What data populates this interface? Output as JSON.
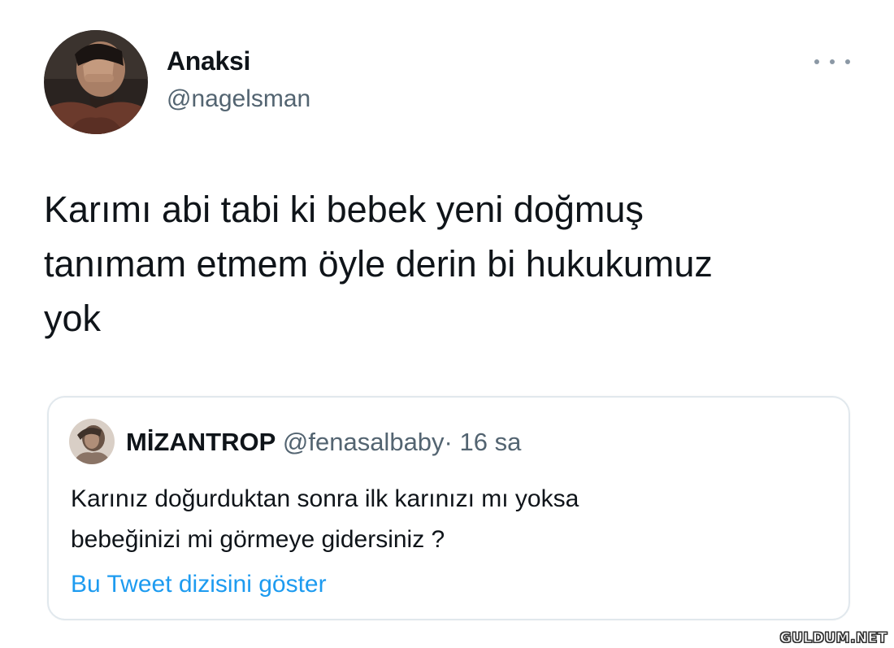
{
  "tweet": {
    "author": {
      "display_name": "Anaksi",
      "handle": "@nagelsman",
      "avatar_icon": "avatar-person-hand-on-face"
    },
    "more_icon": "more-horizontal-icon",
    "text": "Karımı abi tabi ki bebek yeni doğmuş\ntanımam etmem öyle derin bi hukukumuz\nyok"
  },
  "quoted_tweet": {
    "author": {
      "display_name": "MİZANTROP",
      "handle": "@fenasalbaby",
      "avatar_icon": "avatar-small"
    },
    "separator": "·",
    "time": "16 sa",
    "text": "Karınız doğurduktan sonra ilk karınızı mı yoksa\nbebeğinizi mi görmeye gidersiniz ?",
    "thread_link": "Bu Tweet dizisini göster"
  },
  "watermark": "GULDUM.NET",
  "colors": {
    "text": "#0f1419",
    "secondary": "#536471",
    "link": "#1d9bf0",
    "border": "#e1e8ed"
  }
}
